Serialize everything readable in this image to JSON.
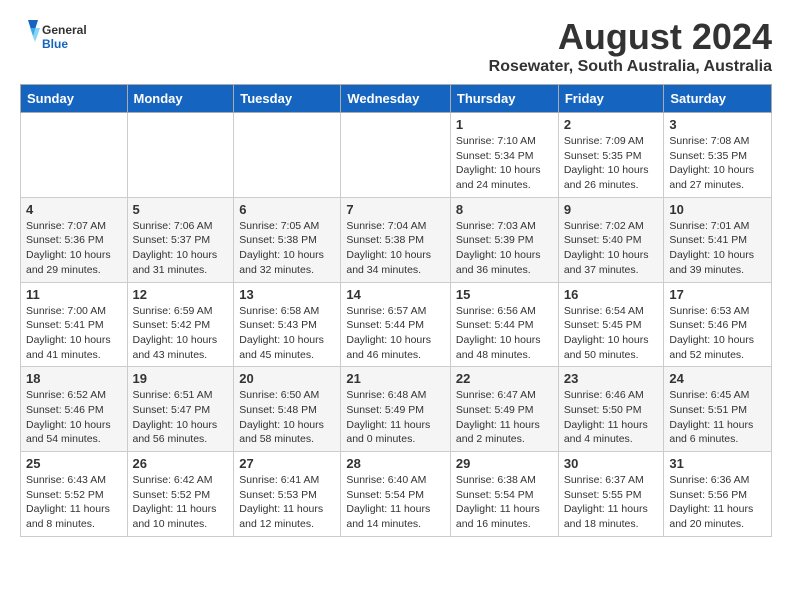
{
  "logo": {
    "general": "General",
    "blue": "Blue"
  },
  "title": "August 2024",
  "subtitle": "Rosewater, South Australia, Australia",
  "days_of_week": [
    "Sunday",
    "Monday",
    "Tuesday",
    "Wednesday",
    "Thursday",
    "Friday",
    "Saturday"
  ],
  "weeks": [
    [
      {
        "day": "",
        "content": ""
      },
      {
        "day": "",
        "content": ""
      },
      {
        "day": "",
        "content": ""
      },
      {
        "day": "",
        "content": ""
      },
      {
        "day": "1",
        "content": "Sunrise: 7:10 AM\nSunset: 5:34 PM\nDaylight: 10 hours\nand 24 minutes."
      },
      {
        "day": "2",
        "content": "Sunrise: 7:09 AM\nSunset: 5:35 PM\nDaylight: 10 hours\nand 26 minutes."
      },
      {
        "day": "3",
        "content": "Sunrise: 7:08 AM\nSunset: 5:35 PM\nDaylight: 10 hours\nand 27 minutes."
      }
    ],
    [
      {
        "day": "4",
        "content": "Sunrise: 7:07 AM\nSunset: 5:36 PM\nDaylight: 10 hours\nand 29 minutes."
      },
      {
        "day": "5",
        "content": "Sunrise: 7:06 AM\nSunset: 5:37 PM\nDaylight: 10 hours\nand 31 minutes."
      },
      {
        "day": "6",
        "content": "Sunrise: 7:05 AM\nSunset: 5:38 PM\nDaylight: 10 hours\nand 32 minutes."
      },
      {
        "day": "7",
        "content": "Sunrise: 7:04 AM\nSunset: 5:38 PM\nDaylight: 10 hours\nand 34 minutes."
      },
      {
        "day": "8",
        "content": "Sunrise: 7:03 AM\nSunset: 5:39 PM\nDaylight: 10 hours\nand 36 minutes."
      },
      {
        "day": "9",
        "content": "Sunrise: 7:02 AM\nSunset: 5:40 PM\nDaylight: 10 hours\nand 37 minutes."
      },
      {
        "day": "10",
        "content": "Sunrise: 7:01 AM\nSunset: 5:41 PM\nDaylight: 10 hours\nand 39 minutes."
      }
    ],
    [
      {
        "day": "11",
        "content": "Sunrise: 7:00 AM\nSunset: 5:41 PM\nDaylight: 10 hours\nand 41 minutes."
      },
      {
        "day": "12",
        "content": "Sunrise: 6:59 AM\nSunset: 5:42 PM\nDaylight: 10 hours\nand 43 minutes."
      },
      {
        "day": "13",
        "content": "Sunrise: 6:58 AM\nSunset: 5:43 PM\nDaylight: 10 hours\nand 45 minutes."
      },
      {
        "day": "14",
        "content": "Sunrise: 6:57 AM\nSunset: 5:44 PM\nDaylight: 10 hours\nand 46 minutes."
      },
      {
        "day": "15",
        "content": "Sunrise: 6:56 AM\nSunset: 5:44 PM\nDaylight: 10 hours\nand 48 minutes."
      },
      {
        "day": "16",
        "content": "Sunrise: 6:54 AM\nSunset: 5:45 PM\nDaylight: 10 hours\nand 50 minutes."
      },
      {
        "day": "17",
        "content": "Sunrise: 6:53 AM\nSunset: 5:46 PM\nDaylight: 10 hours\nand 52 minutes."
      }
    ],
    [
      {
        "day": "18",
        "content": "Sunrise: 6:52 AM\nSunset: 5:46 PM\nDaylight: 10 hours\nand 54 minutes."
      },
      {
        "day": "19",
        "content": "Sunrise: 6:51 AM\nSunset: 5:47 PM\nDaylight: 10 hours\nand 56 minutes."
      },
      {
        "day": "20",
        "content": "Sunrise: 6:50 AM\nSunset: 5:48 PM\nDaylight: 10 hours\nand 58 minutes."
      },
      {
        "day": "21",
        "content": "Sunrise: 6:48 AM\nSunset: 5:49 PM\nDaylight: 11 hours\nand 0 minutes."
      },
      {
        "day": "22",
        "content": "Sunrise: 6:47 AM\nSunset: 5:49 PM\nDaylight: 11 hours\nand 2 minutes."
      },
      {
        "day": "23",
        "content": "Sunrise: 6:46 AM\nSunset: 5:50 PM\nDaylight: 11 hours\nand 4 minutes."
      },
      {
        "day": "24",
        "content": "Sunrise: 6:45 AM\nSunset: 5:51 PM\nDaylight: 11 hours\nand 6 minutes."
      }
    ],
    [
      {
        "day": "25",
        "content": "Sunrise: 6:43 AM\nSunset: 5:52 PM\nDaylight: 11 hours\nand 8 minutes."
      },
      {
        "day": "26",
        "content": "Sunrise: 6:42 AM\nSunset: 5:52 PM\nDaylight: 11 hours\nand 10 minutes."
      },
      {
        "day": "27",
        "content": "Sunrise: 6:41 AM\nSunset: 5:53 PM\nDaylight: 11 hours\nand 12 minutes."
      },
      {
        "day": "28",
        "content": "Sunrise: 6:40 AM\nSunset: 5:54 PM\nDaylight: 11 hours\nand 14 minutes."
      },
      {
        "day": "29",
        "content": "Sunrise: 6:38 AM\nSunset: 5:54 PM\nDaylight: 11 hours\nand 16 minutes."
      },
      {
        "day": "30",
        "content": "Sunrise: 6:37 AM\nSunset: 5:55 PM\nDaylight: 11 hours\nand 18 minutes."
      },
      {
        "day": "31",
        "content": "Sunrise: 6:36 AM\nSunset: 5:56 PM\nDaylight: 11 hours\nand 20 minutes."
      }
    ]
  ]
}
